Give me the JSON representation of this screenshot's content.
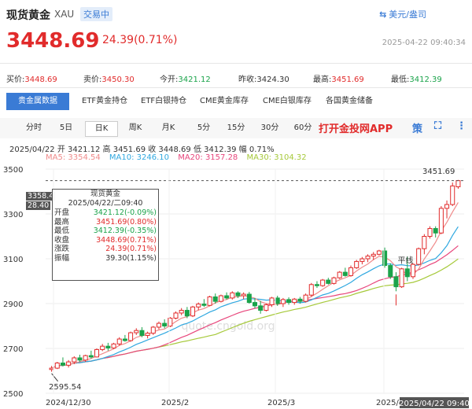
{
  "header": {
    "title": "现货黄金",
    "symbol": "XAU",
    "status": "交易中",
    "currency_switch": "美元/盎司",
    "price": "3448.69",
    "change": "24.39(0.71%)",
    "timestamp": "2025-04-22 09:40:34"
  },
  "quote": [
    {
      "label": "买价:",
      "value": "3448.69",
      "color": "red"
    },
    {
      "label": "卖价:",
      "value": "3450.30",
      "color": "red"
    },
    {
      "label": "今开:",
      "value": "3421.12",
      "color": "green"
    },
    {
      "label": "昨收:",
      "value": "3424.30",
      "color": "plain"
    },
    {
      "label": "最高:",
      "value": "3451.69",
      "color": "red"
    },
    {
      "label": "最低:",
      "value": "3412.39",
      "color": "green"
    }
  ],
  "data_tabs": [
    "贵金属数据",
    "ETF黄金持仓",
    "ETF白银持仓",
    "CME黄金库存",
    "CME白银库存",
    "各国黄金储备"
  ],
  "period_tabs": [
    "分时",
    "5日",
    "日K",
    "周K",
    "月K",
    "5分",
    "15分",
    "30分",
    "60分"
  ],
  "promo": "打开金投网APP",
  "toolbar_icons": [
    "策",
    "⛶",
    "⋮"
  ],
  "info": {
    "line1": "2025/04/22  开 3421.12  高 3451.69  收 3448.69  低 3412.39  幅 0.71%",
    "ma5": "MA5: 3354.54",
    "ma10": "MA10: 3246.10",
    "ma20": "MA20: 3157.28",
    "ma30": "MA30: 3104.32"
  },
  "tooltip": {
    "title": "现货黄金",
    "date": "2025/04/22/二09:40",
    "rows": [
      {
        "label": "开盘",
        "value": "3421.12(-0.09%)",
        "color": "green"
      },
      {
        "label": "最高",
        "value": "3451.69(0.80%)",
        "color": "red"
      },
      {
        "label": "最低",
        "value": "3412.39(-0.35%)",
        "color": "green"
      },
      {
        "label": "收盘",
        "value": "3448.69(0.71%)",
        "color": "red"
      },
      {
        "label": "涨跌",
        "value": "24.39(0.71%)",
        "color": "red"
      },
      {
        "label": "振幅",
        "value": "39.30(1.15%)",
        "color": "plain"
      }
    ],
    "price_box_1": "3358.4",
    "price_box_2": "28.40"
  },
  "colors": {
    "up": "#e12b2b",
    "down": "#1aa34a",
    "ma5": "#f08b8b",
    "ma10": "#2fa8e0",
    "ma20": "#e8467c",
    "ma30": "#a6c93a",
    "accent": "#3a7bd5"
  },
  "chart_data": {
    "type": "candlestick",
    "yticks": [
      "3500",
      "3300",
      "3100",
      "2900",
      "2700",
      "2500"
    ],
    "ylim": [
      2500,
      3500
    ],
    "xticks": [
      "2024/12/30",
      "2025/2",
      "2025/3",
      "2025/4",
      "2025/04/22 09:40"
    ],
    "high_label": "3451.69",
    "low_label": "2595.54",
    "annotation_text": "平线",
    "watermark": "quote.cngold.org",
    "candles": [
      {
        "o": 2606,
        "h": 2622,
        "l": 2596,
        "c": 2612
      },
      {
        "o": 2612,
        "h": 2640,
        "l": 2608,
        "c": 2635
      },
      {
        "o": 2635,
        "h": 2660,
        "l": 2620,
        "c": 2625
      },
      {
        "o": 2625,
        "h": 2648,
        "l": 2615,
        "c": 2640
      },
      {
        "o": 2640,
        "h": 2665,
        "l": 2630,
        "c": 2658
      },
      {
        "o": 2658,
        "h": 2672,
        "l": 2640,
        "c": 2648
      },
      {
        "o": 2648,
        "h": 2672,
        "l": 2640,
        "c": 2668
      },
      {
        "o": 2668,
        "h": 2690,
        "l": 2655,
        "c": 2662
      },
      {
        "o": 2662,
        "h": 2700,
        "l": 2660,
        "c": 2695
      },
      {
        "o": 2695,
        "h": 2720,
        "l": 2688,
        "c": 2710
      },
      {
        "o": 2710,
        "h": 2725,
        "l": 2690,
        "c": 2702
      },
      {
        "o": 2702,
        "h": 2725,
        "l": 2698,
        "c": 2720
      },
      {
        "o": 2720,
        "h": 2750,
        "l": 2712,
        "c": 2742
      },
      {
        "o": 2742,
        "h": 2760,
        "l": 2730,
        "c": 2735
      },
      {
        "o": 2735,
        "h": 2775,
        "l": 2730,
        "c": 2770
      },
      {
        "o": 2770,
        "h": 2790,
        "l": 2760,
        "c": 2780
      },
      {
        "o": 2780,
        "h": 2795,
        "l": 2750,
        "c": 2758
      },
      {
        "o": 2758,
        "h": 2775,
        "l": 2745,
        "c": 2768
      },
      {
        "o": 2768,
        "h": 2800,
        "l": 2760,
        "c": 2795
      },
      {
        "o": 2795,
        "h": 2820,
        "l": 2785,
        "c": 2812
      },
      {
        "o": 2812,
        "h": 2830,
        "l": 2790,
        "c": 2800
      },
      {
        "o": 2800,
        "h": 2840,
        "l": 2795,
        "c": 2835
      },
      {
        "o": 2835,
        "h": 2865,
        "l": 2830,
        "c": 2858
      },
      {
        "o": 2858,
        "h": 2880,
        "l": 2848,
        "c": 2870
      },
      {
        "o": 2870,
        "h": 2885,
        "l": 2835,
        "c": 2845
      },
      {
        "o": 2845,
        "h": 2890,
        "l": 2840,
        "c": 2885
      },
      {
        "o": 2885,
        "h": 2905,
        "l": 2870,
        "c": 2898
      },
      {
        "o": 2898,
        "h": 2920,
        "l": 2885,
        "c": 2892
      },
      {
        "o": 2892,
        "h": 2935,
        "l": 2888,
        "c": 2930
      },
      {
        "o": 2930,
        "h": 2945,
        "l": 2900,
        "c": 2910
      },
      {
        "o": 2910,
        "h": 2940,
        "l": 2905,
        "c": 2935
      },
      {
        "o": 2935,
        "h": 2950,
        "l": 2918,
        "c": 2925
      },
      {
        "o": 2925,
        "h": 2955,
        "l": 2918,
        "c": 2948
      },
      {
        "o": 2948,
        "h": 2955,
        "l": 2925,
        "c": 2935
      },
      {
        "o": 2935,
        "h": 2950,
        "l": 2920,
        "c": 2942
      },
      {
        "o": 2942,
        "h": 2952,
        "l": 2900,
        "c": 2905
      },
      {
        "o": 2905,
        "h": 2925,
        "l": 2880,
        "c": 2890
      },
      {
        "o": 2890,
        "h": 2912,
        "l": 2855,
        "c": 2870
      },
      {
        "o": 2870,
        "h": 2900,
        "l": 2865,
        "c": 2895
      },
      {
        "o": 2895,
        "h": 2930,
        "l": 2885,
        "c": 2925
      },
      {
        "o": 2925,
        "h": 2935,
        "l": 2890,
        "c": 2900
      },
      {
        "o": 2900,
        "h": 2925,
        "l": 2885,
        "c": 2918
      },
      {
        "o": 2918,
        "h": 2928,
        "l": 2895,
        "c": 2905
      },
      {
        "o": 2905,
        "h": 2925,
        "l": 2895,
        "c": 2920
      },
      {
        "o": 2920,
        "h": 2930,
        "l": 2900,
        "c": 2910
      },
      {
        "o": 2910,
        "h": 2945,
        "l": 2905,
        "c": 2938
      },
      {
        "o": 2938,
        "h": 2992,
        "l": 2930,
        "c": 2985
      },
      {
        "o": 2985,
        "h": 3000,
        "l": 2970,
        "c": 2980
      },
      {
        "o": 2980,
        "h": 3010,
        "l": 2975,
        "c": 3005
      },
      {
        "o": 3005,
        "h": 3015,
        "l": 2985,
        "c": 2990
      },
      {
        "o": 2990,
        "h": 3020,
        "l": 2985,
        "c": 3015
      },
      {
        "o": 3015,
        "h": 3045,
        "l": 3010,
        "c": 3040
      },
      {
        "o": 3040,
        "h": 3060,
        "l": 3020,
        "c": 3025
      },
      {
        "o": 3025,
        "h": 3070,
        "l": 3020,
        "c": 3060
      },
      {
        "o": 3060,
        "h": 3095,
        "l": 3055,
        "c": 3088
      },
      {
        "o": 3088,
        "h": 3108,
        "l": 3075,
        "c": 3100
      },
      {
        "o": 3100,
        "h": 3120,
        "l": 3085,
        "c": 3112
      },
      {
        "o": 3112,
        "h": 3130,
        "l": 3095,
        "c": 3120
      },
      {
        "o": 3120,
        "h": 3140,
        "l": 3115,
        "c": 3135
      },
      {
        "o": 3135,
        "h": 3150,
        "l": 3060,
        "c": 3070
      },
      {
        "o": 3070,
        "h": 3080,
        "l": 3010,
        "c": 3020
      },
      {
        "o": 3020,
        "h": 3040,
        "l": 2955,
        "c": 2975
      },
      {
        "o": 2975,
        "h": 3060,
        "l": 2970,
        "c": 3055
      },
      {
        "o": 3055,
        "h": 3110,
        "l": 3000,
        "c": 3020
      },
      {
        "o": 3020,
        "h": 3080,
        "l": 3010,
        "c": 3075
      },
      {
        "o": 3075,
        "h": 3150,
        "l": 3070,
        "c": 3145
      },
      {
        "o": 3145,
        "h": 3210,
        "l": 3120,
        "c": 3200
      },
      {
        "o": 3200,
        "h": 3245,
        "l": 3190,
        "c": 3235
      },
      {
        "o": 3235,
        "h": 3245,
        "l": 3195,
        "c": 3215
      },
      {
        "o": 3215,
        "h": 3335,
        "l": 3210,
        "c": 3325
      },
      {
        "o": 3325,
        "h": 3360,
        "l": 3280,
        "c": 3342
      },
      {
        "o": 3342,
        "h": 3440,
        "l": 3335,
        "c": 3425
      },
      {
        "o": 3421.12,
        "h": 3451.69,
        "l": 3412.39,
        "c": 3448.69
      }
    ]
  }
}
